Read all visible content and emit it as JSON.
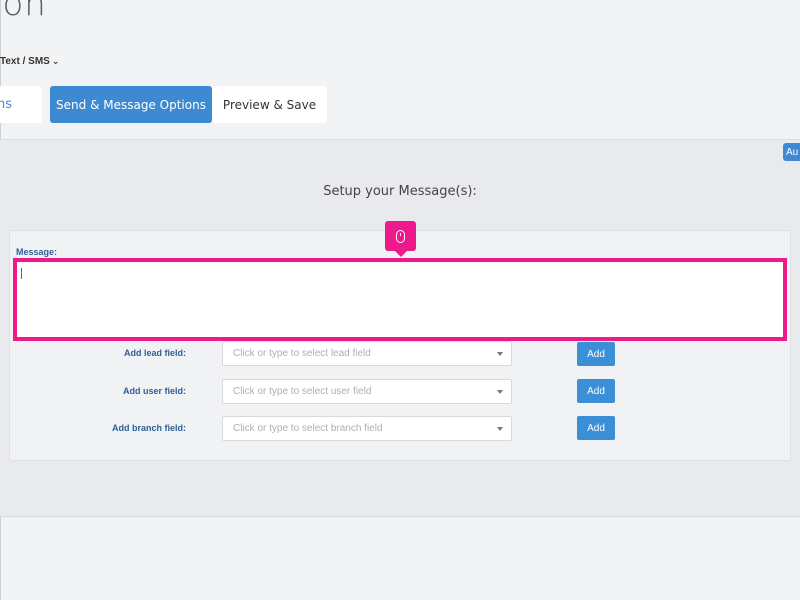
{
  "page": {
    "title": "ion"
  },
  "channel_select": {
    "value": "Text / SMS"
  },
  "tabs": [
    {
      "label": "ns"
    },
    {
      "label": "Send & Message Options"
    },
    {
      "label": "Preview & Save"
    }
  ],
  "auto_badge": {
    "label": "Au"
  },
  "setup": {
    "heading": "Setup your Message(s):"
  },
  "message": {
    "label": "Message:",
    "value": ""
  },
  "fields": [
    {
      "label": "Add lead field:",
      "placeholder": "Click or type to select lead field",
      "button": "Add"
    },
    {
      "label": "Add user field:",
      "placeholder": "Click or type to select user field",
      "button": "Add"
    },
    {
      "label": "Add branch field:",
      "placeholder": "Click or type to select branch field",
      "button": "Add"
    }
  ],
  "colors": {
    "accent": "#3d8ad2",
    "highlight": "#ee1a8c",
    "label": "#2d5f99"
  },
  "icons": {
    "click_marker": "mouse-icon",
    "dropdown": "chevron-down-icon"
  }
}
